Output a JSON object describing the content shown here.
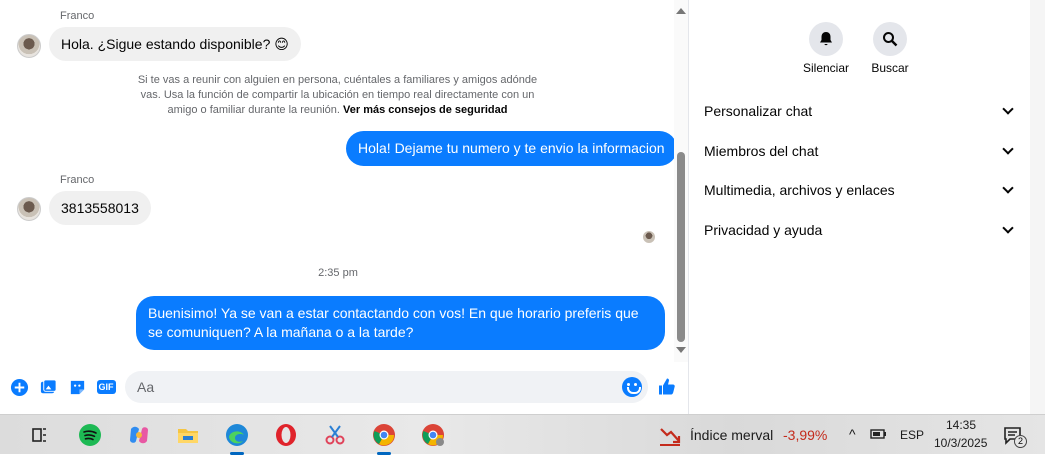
{
  "chat": {
    "messages": [
      {
        "sender": "Franco",
        "text": "Hola. ¿Sigue estando disponible?",
        "emoji": "😊"
      },
      {
        "notice": "Si te vas a reunir con alguien en persona, cuéntales a familiares y amigos adónde vas. Usa la función de compartir la ubicación en tiempo real directamente con un amigo o familiar durante la reunión.",
        "notice_link": "Ver más consejos de seguridad"
      },
      {
        "out": "Hola! Dejame tu numero y te envio la informacion"
      },
      {
        "sender": "Franco",
        "text": "3813558013"
      },
      {
        "time": "2:35 pm"
      },
      {
        "out": "Buenisimo! Ya se van a estar contactando con vos! En que horario preferis que se comuniquen? A la mañana o a la tarde?"
      }
    ],
    "composer": {
      "placeholder": "Aa",
      "gif_label": "GIF"
    }
  },
  "side": {
    "actions": [
      {
        "label": "Silenciar",
        "icon": "bell-icon"
      },
      {
        "label": "Buscar",
        "icon": "search-icon"
      }
    ],
    "sections": [
      "Personalizar chat",
      "Miembros del chat",
      "Multimedia, archivos y enlaces",
      "Privacidad y ayuda"
    ]
  },
  "taskbar": {
    "stock_name": "Índice merval",
    "stock_change": "-3,99%",
    "language": "ESP",
    "time": "14:35",
    "date": "10/3/2025",
    "notification_count": "2"
  },
  "colors": {
    "accent": "#0a7cff",
    "bubble_in": "#f0f0f0",
    "stock_down": "#c42b1c"
  }
}
